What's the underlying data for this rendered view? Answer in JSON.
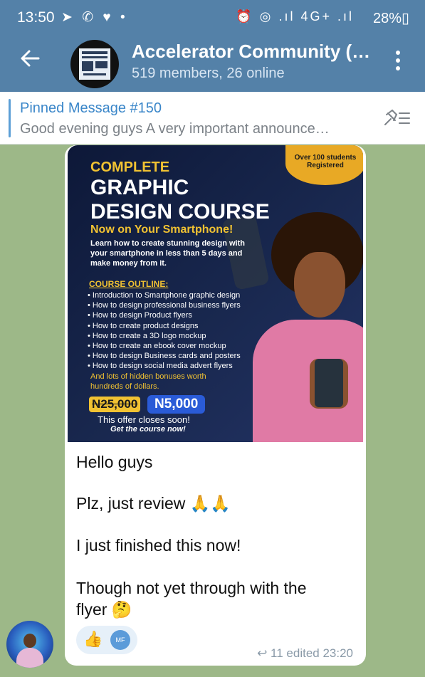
{
  "status_bar": {
    "time": "13:50",
    "left_icons": "➤ ✆ ♥ •",
    "right_icons": "⏰ ◎ .ıl 4G+ .ıl",
    "battery": "28%▯"
  },
  "header": {
    "title": "Accelerator Community (…",
    "subtitle": "519 members, 26 online"
  },
  "pinned": {
    "title": "Pinned Message #150",
    "text": "Good evening guys   A very important announce…"
  },
  "poster": {
    "badge": "Over 100 students Registered",
    "line1": "COMPLETE",
    "line2": "GRAPHIC",
    "line3": "DESIGN COURSE",
    "line4": "Now on Your Smartphone!",
    "intro": "Learn how to create stunning design with your smartphone in less than 5 days and make money from it.",
    "outline_header": "COURSE OUTLINE:",
    "outline": [
      "Introduction to Smartphone graphic design",
      "How to design professional business flyers",
      "How to design Product flyers",
      "How to create product designs",
      "How to create a 3D logo mockup",
      "How to create an ebook cover mockup",
      "How to design Business cards and posters",
      "How to design social media advert flyers"
    ],
    "bonus": "And lots of hidden bonuses worth hundreds of dollars.",
    "old_price": "N25,000",
    "new_price": "N5,000",
    "offer": "This offer closes soon!",
    "cta": "Get the course now!"
  },
  "message": {
    "p1": "Hello guys",
    "p2": "Plz,  just review 🙏🙏",
    "p3": "I just finished this now!",
    "p4": "Though not yet through with the flyer 🤔",
    "reaction_emoji": "👍",
    "reaction_user": "MF",
    "meta": "↩ 11   edited 23:20"
  },
  "colors": {
    "header_bg": "#5481a8",
    "pinned_title": "#3a86c9",
    "chat_bg": "#9db888"
  }
}
